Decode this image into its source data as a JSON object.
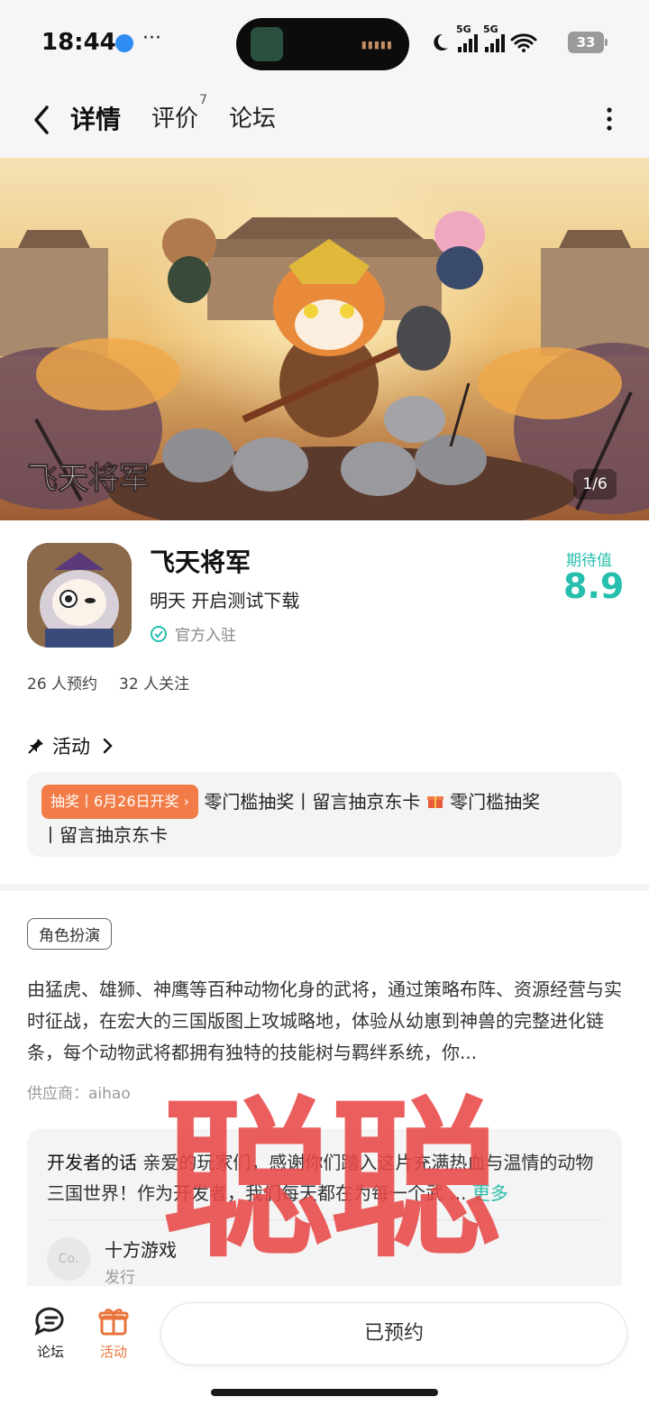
{
  "status_bar": {
    "time": "18:44",
    "more": "···",
    "net_tag_1": "5G",
    "net_tag_2": "5G",
    "battery": "33",
    "icons": [
      "moon-icon",
      "signal-icon",
      "signal-icon",
      "wifi-icon",
      "battery-icon"
    ]
  },
  "nav": {
    "tabs": [
      {
        "label": "详情",
        "active": true
      },
      {
        "label": "评价",
        "badge": "7"
      },
      {
        "label": "论坛"
      }
    ]
  },
  "banner": {
    "logo_text": "飞天将军",
    "counter": "1/6"
  },
  "app": {
    "name": "飞天将军",
    "test_info": "明天 开启测试下载",
    "official": "官方入驻",
    "expect_label": "期待值",
    "expect_value": "8.9",
    "reservations": "26 人预约",
    "followers": "32 人关注"
  },
  "activity": {
    "title": "活动",
    "badge": "抽奖丨6月26日开奖",
    "line1_a": "零门槛抽奖丨留言抽京东卡",
    "line1_b": "零门槛抽奖",
    "line2": "丨留言抽京东卡"
  },
  "game": {
    "genre": "角色扮演",
    "description": "由猛虎、雄狮、神鹰等百种动物化身的武将，通过策略布阵、资源经营与实时征战，在宏大的三国版图上攻城略地，体验从幼崽到神兽的完整进化链条，每个动物武将都拥有独特的技能树与羁绊系统，你...",
    "supplier": "供应商：aihao"
  },
  "developer": {
    "lead": "开发者的话",
    "text_1": " 亲爱的玩家们，感谢你们踏入这片充满热血与温情",
    "text_2": "的动物三国世界！作为开发者，我们每天都在为每一个武 ... ",
    "more": "更多",
    "publisher_avatar": "Co.",
    "publisher_name": "十方游戏",
    "publisher_role": "发行"
  },
  "watermark": "聪聪",
  "bottom_bar": {
    "forum_label": "论坛",
    "activity_label": "活动",
    "reserved_label": "已预约"
  },
  "colors": {
    "accent": "#26bfae",
    "tab_underline": "#3ccfbe",
    "activity_orange": "#e8743c",
    "badge_orange": "#f17c47",
    "watermark_red": "#e84848"
  }
}
